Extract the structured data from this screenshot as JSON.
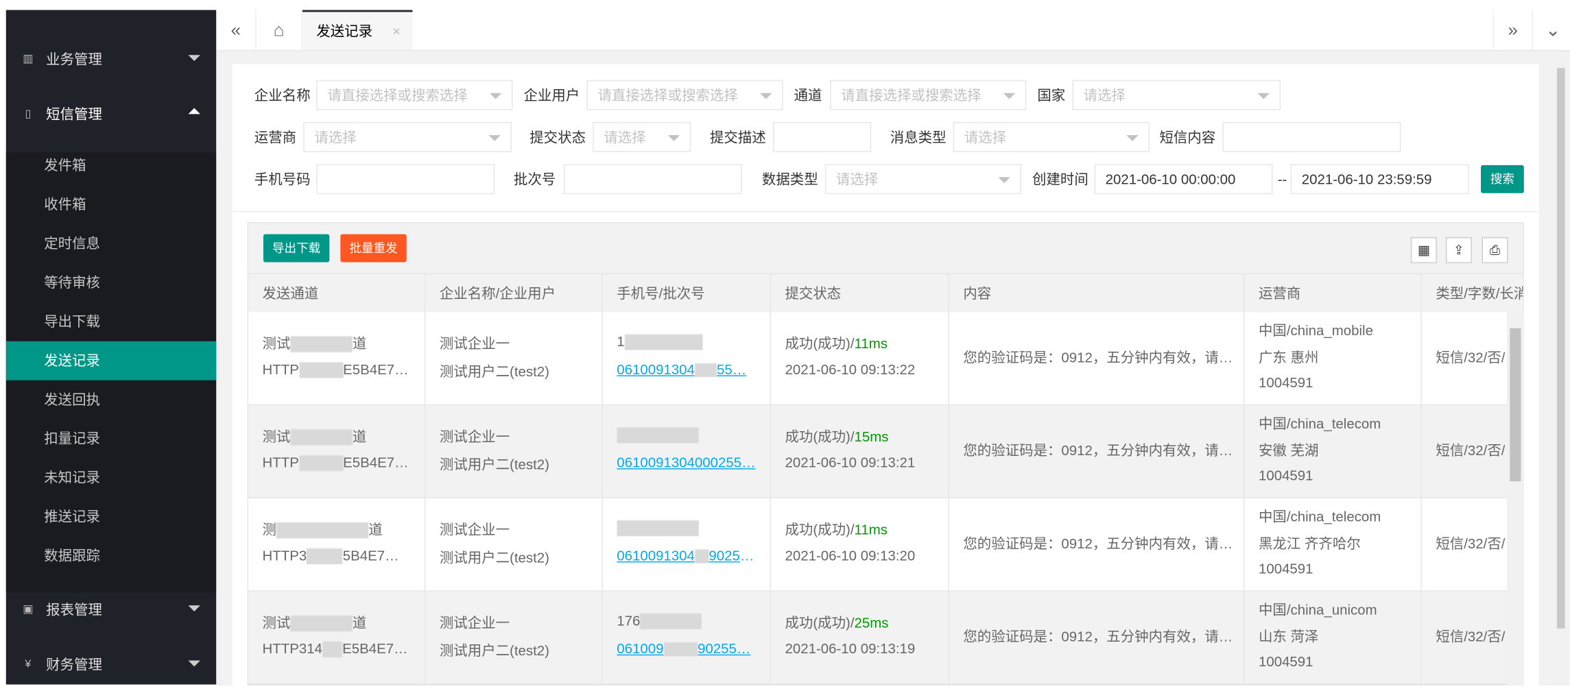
{
  "sidebar": {
    "groups": [
      {
        "label": "业务管理",
        "icon": "chart-icon"
      },
      {
        "label": "短信管理",
        "icon": "phone-icon"
      },
      {
        "label": "报表管理",
        "icon": "report-icon"
      },
      {
        "label": "财务管理",
        "icon": "yen-icon"
      }
    ],
    "items": [
      "发件箱",
      "收件箱",
      "定时信息",
      "等待审核",
      "导出下载",
      "发送记录",
      "发送回执",
      "扣量记录",
      "未知记录",
      "推送记录",
      "数据跟踪"
    ],
    "active_index": 5
  },
  "tabs": {
    "active_label": "发送记录",
    "close": "×"
  },
  "filters": {
    "company_label": "企业名称",
    "company_placeholder": "请直接选择或搜索选择",
    "user_label": "企业用户",
    "user_placeholder": "请直接选择或搜索选择",
    "channel_label": "通道",
    "channel_placeholder": "请直接选择或搜索选择",
    "country_label": "国家",
    "country_placeholder": "请选择",
    "carrier_label": "运营商",
    "carrier_placeholder": "请选择",
    "submit_status_label": "提交状态",
    "submit_status_placeholder": "请选择",
    "submit_desc_label": "提交描述",
    "msg_type_label": "消息类型",
    "msg_type_placeholder": "请选择",
    "sms_content_label": "短信内容",
    "phone_label": "手机号码",
    "batch_label": "批次号",
    "data_type_label": "数据类型",
    "data_type_placeholder": "请选择",
    "created_label": "创建时间",
    "start_time": "2021-06-10 00:00:00",
    "range_sep": "--",
    "end_time": "2021-06-10 23:59:59",
    "search_label": "搜索"
  },
  "toolbar": {
    "export_label": "导出下载",
    "resend_label": "批量重发"
  },
  "table": {
    "headers": [
      "发送通道",
      "企业名称/企业用户",
      "手机号/批次号",
      "提交状态",
      "内容",
      "运营商",
      "类型/字数/长消"
    ],
    "rows": [
      {
        "ch1": "测试",
        "ch1b": "道",
        "ch2": "HTTP",
        "ch2b": "E5B4E7…",
        "comp": "测试企业一",
        "user": "测试用户二(test2)",
        "phone": "1",
        "batch": "0610091304",
        "batch_tail": "55…",
        "status": "成功(成功)/",
        "ms": "11ms",
        "time": "2021-06-10 09:13:22",
        "content": "您的验证码是：0912，五分钟内有效，请…",
        "carrier": "中国/china_mobile",
        "region": "广东 惠州",
        "code": "1004591",
        "type": "短信/32/否/"
      },
      {
        "ch1": "测试",
        "ch1b": "道",
        "ch2": "HTTP",
        "ch2b": "E5B4E7…",
        "comp": "测试企业一",
        "user": "测试用户二(test2)",
        "phone": "",
        "batch": "0610091304000",
        "batch_tail": "255…",
        "status": "成功(成功)/",
        "ms": "15ms",
        "time": "2021-06-10 09:13:21",
        "content": "您的验证码是：0912，五分钟内有效，请…",
        "carrier": "中国/china_telecom",
        "region": "安徽 芜湖",
        "code": "1004591",
        "type": "短信/32/否/"
      },
      {
        "ch1": "测",
        "ch1b": "道",
        "ch2": "HTTP3",
        "ch2b": "5B4E7…",
        "comp": "测试企业一",
        "user": "测试用户二(test2)",
        "phone": "",
        "batch": "0610091304",
        "batch_tail": "90255…",
        "status": "成功(成功)/",
        "ms": "11ms",
        "time": "2021-06-10 09:13:20",
        "content": "您的验证码是：0912，五分钟内有效，请…",
        "carrier": "中国/china_telecom",
        "region": "黑龙江 齐齐哈尔",
        "code": "1004591",
        "type": "短信/32/否/"
      },
      {
        "ch1": "测试",
        "ch1b": "道",
        "ch2": "HTTP314",
        "ch2b": "E5B4E7…",
        "comp": "测试企业一",
        "user": "测试用户二(test2)",
        "phone": "176",
        "batch": "061009",
        "batch_tail": "90255…",
        "status": "成功(成功)/",
        "ms": "25ms",
        "time": "2021-06-10 09:13:19",
        "content": "您的验证码是：0912，五分钟内有效，请…",
        "carrier": "中国/china_unicom",
        "region": "山东 菏泽",
        "code": "1004591",
        "type": "短信/32/否/"
      }
    ]
  },
  "colors": {
    "sidebar_bg": "#20222a",
    "accent": "#009688",
    "danger": "#ff5722",
    "link": "#01aaed",
    "success": "#009900"
  }
}
